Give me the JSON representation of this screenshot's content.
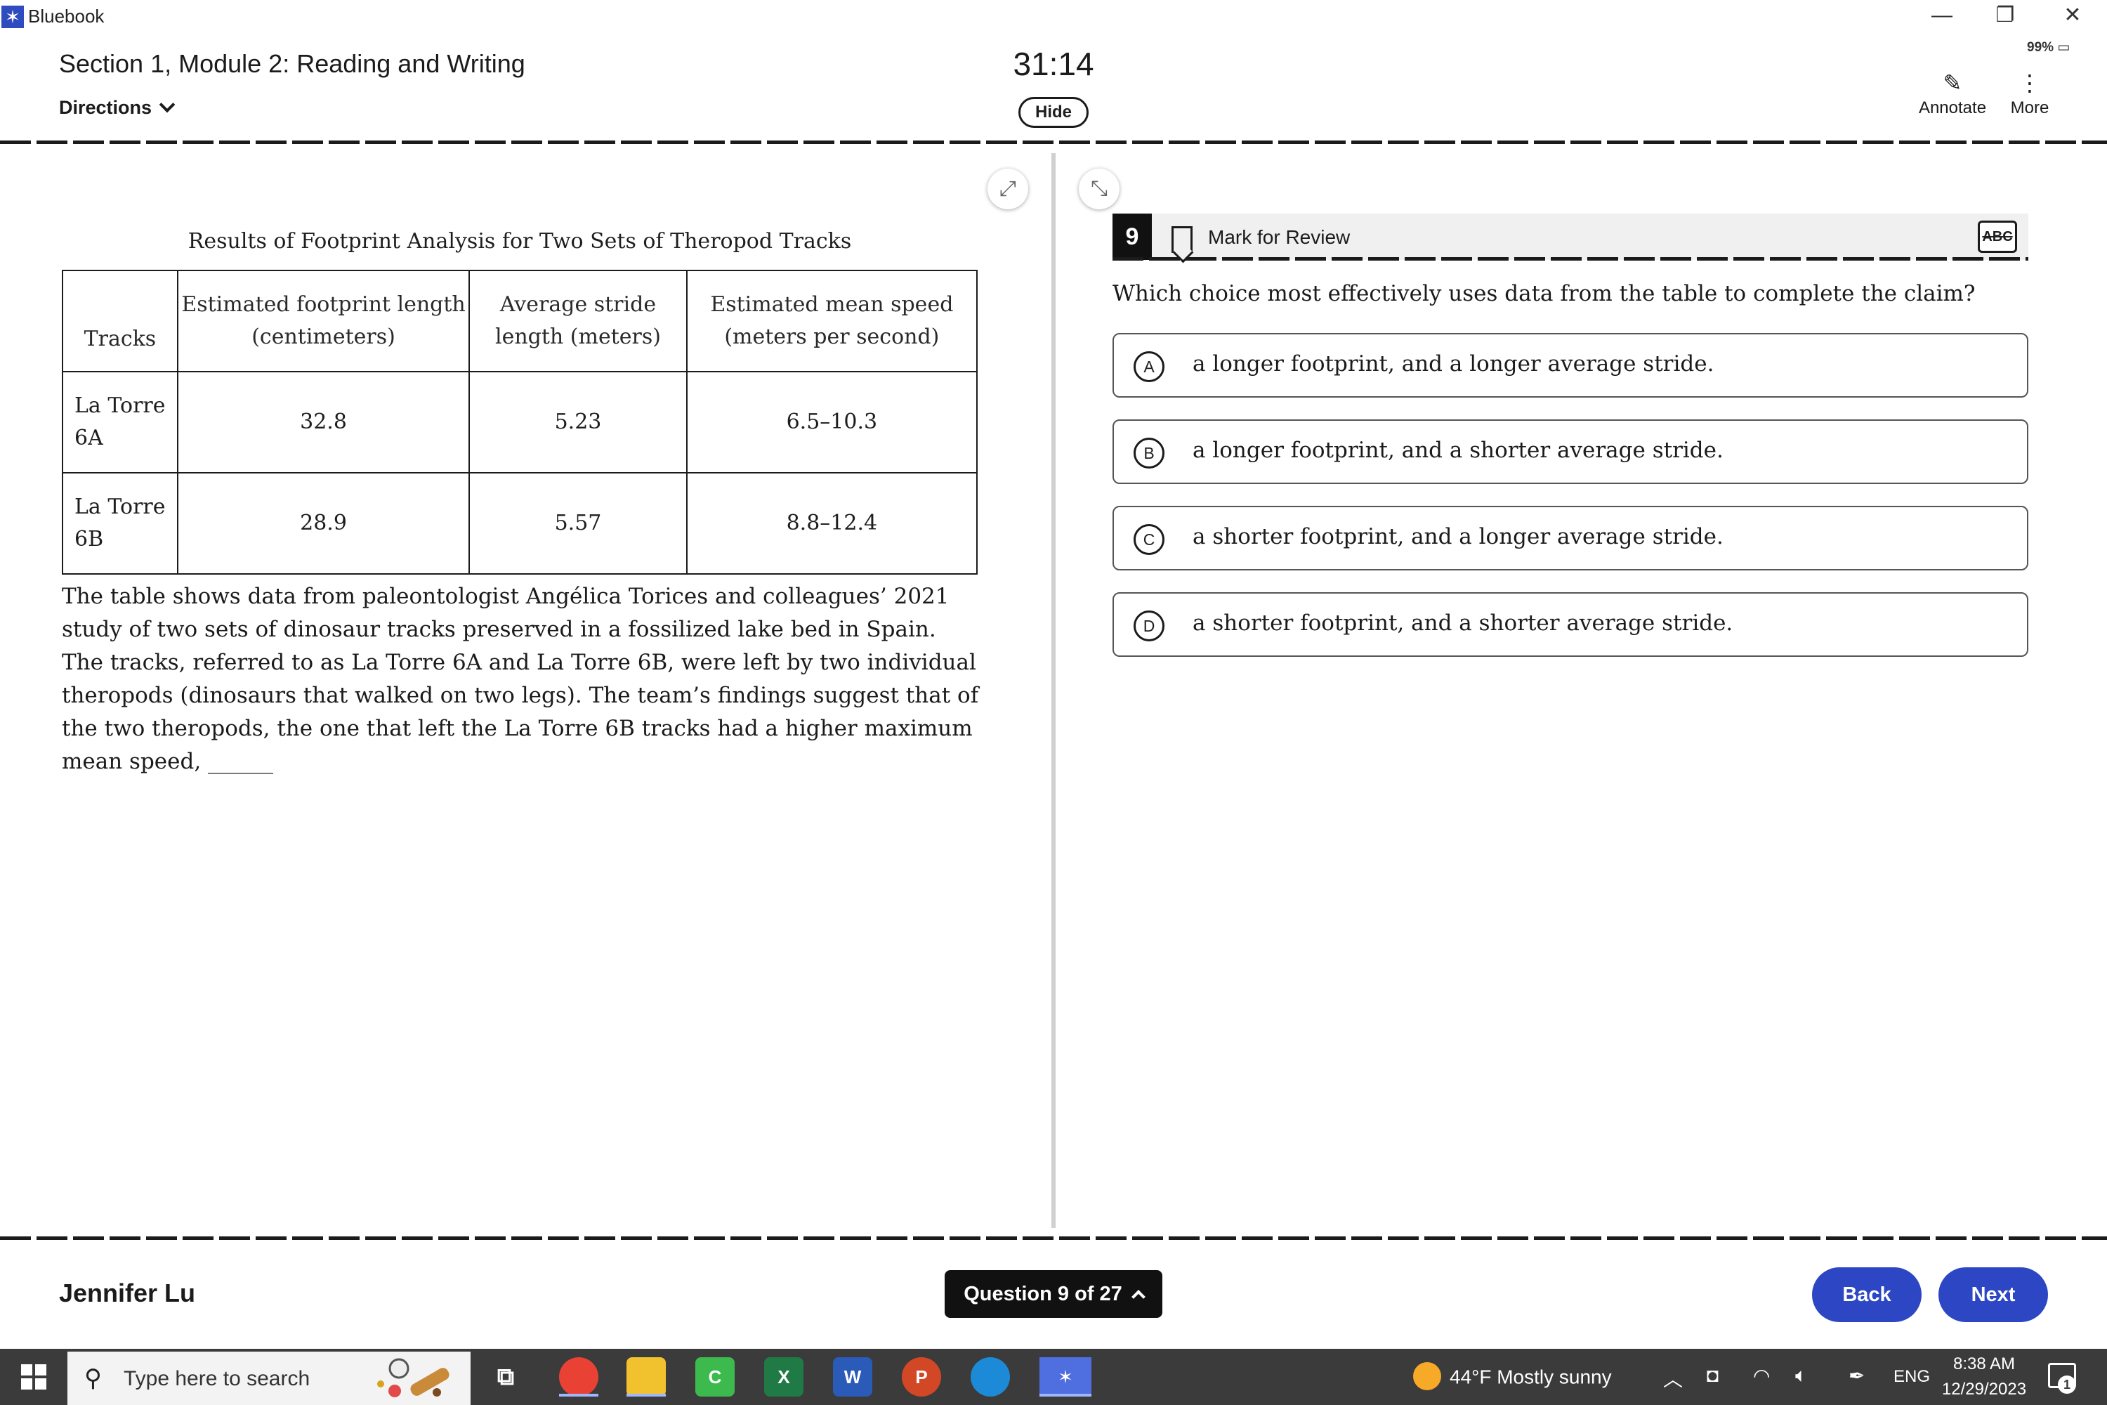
{
  "window": {
    "title": "Bluebook",
    "minimize": "—",
    "restore": "❐",
    "close": "✕",
    "battery": "99% ▭"
  },
  "header": {
    "section_title": "Section 1, Module 2: Reading and Writing",
    "directions_label": "Directions",
    "timer": "31:14",
    "hide_label": "Hide",
    "annotate_label": "Annotate",
    "more_label": "More"
  },
  "passage": {
    "table_caption": "Results of Footprint Analysis for Two Sets of Theropod Tracks",
    "table": {
      "headers": [
        "Tracks",
        "Estimated footprint length (centimeters)",
        "Average stride length (meters)",
        "Estimated mean speed (meters per second)"
      ],
      "rows": [
        [
          "La Torre 6A",
          "32.8",
          "5.23",
          "6.5–10.3"
        ],
        [
          "La Torre 6B",
          "28.9",
          "5.57",
          "8.8–12.4"
        ]
      ]
    },
    "text": "The table shows data from paleontologist Angélica Torices and colleagues’ 2021 study of two sets of dinosaur tracks preserved in a fossilized lake bed in Spain. The tracks, referred to as La Torre 6A and La Torre 6B, were left by two individual theropods (dinosaurs that walked on two legs). The team’s findings suggest that of the two theropods, the one that left the La Torre 6B tracks had a higher maximum mean speed, ______"
  },
  "question": {
    "number": "9",
    "mark_label": "Mark for Review",
    "abc_label": "ABC",
    "prompt": "Which choice most effectively uses data from the table to complete the claim?",
    "choices": [
      {
        "letter": "A",
        "text": "a longer footprint, and a longer average stride."
      },
      {
        "letter": "B",
        "text": "a longer footprint, and a shorter average stride."
      },
      {
        "letter": "C",
        "text": "a shorter footprint, and a longer average stride."
      },
      {
        "letter": "D",
        "text": "a shorter footprint, and a shorter average stride."
      }
    ]
  },
  "footer": {
    "student_name": "Jennifer Lu",
    "question_nav": "Question 9 of 27",
    "back_label": "Back",
    "next_label": "Next"
  },
  "taskbar": {
    "search_placeholder": "Type here to search",
    "weather": "44°F  Mostly sunny",
    "language": "ENG",
    "time": "8:38 AM",
    "date": "12/29/2023",
    "notification_count": "1",
    "apps": [
      "task-view",
      "chrome",
      "file-explorer",
      "camtasia",
      "excel",
      "word",
      "powerpoint",
      "edge",
      "bluebook"
    ]
  }
}
